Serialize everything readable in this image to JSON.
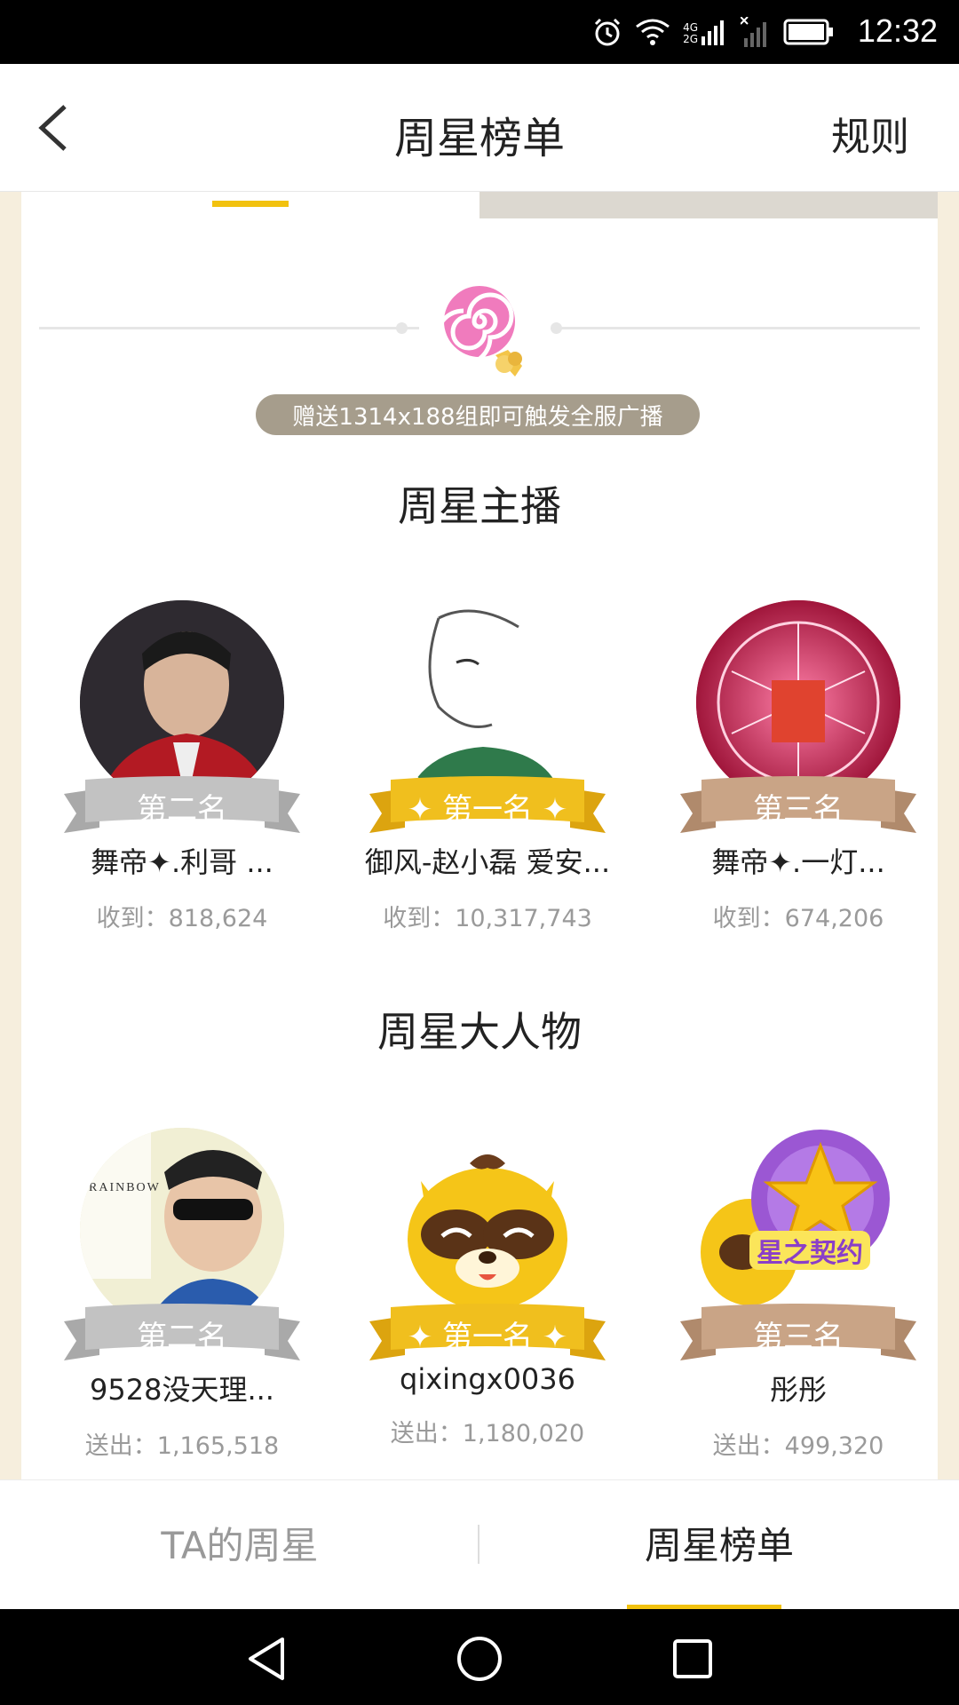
{
  "status_bar": {
    "time": "12:32",
    "icons": [
      "alarm-icon",
      "wifi-icon",
      "signal-4g-icon",
      "signal-2g-icon",
      "battery-icon"
    ],
    "net_label_top": "4G",
    "net_label_bottom": "2G"
  },
  "header": {
    "title": "周星榜单",
    "rules_label": "规则",
    "back_icon": "chevron-left-icon"
  },
  "banner": {
    "gift_icon": "lollipop-icon",
    "hint": "赠送1314x188组即可触发全服广播"
  },
  "anchors": {
    "title": "周星主播",
    "entries": [
      {
        "rank_label": "第二名",
        "name": "舞帝✦.利哥 ...",
        "amount_label": "收到：",
        "amount": "818,624",
        "ribbon": "silver"
      },
      {
        "rank_label": "✦ 第一名 ✦",
        "name": "御风-赵小磊 爱安...",
        "amount_label": "收到：",
        "amount": "10,317,743",
        "ribbon": "gold"
      },
      {
        "rank_label": "第三名",
        "name": "舞帝✦.一灯...",
        "amount_label": "收到：",
        "amount": "674,206",
        "ribbon": "bronze"
      }
    ]
  },
  "bigshots": {
    "title": "周星大人物",
    "entries": [
      {
        "rank_label": "第二名",
        "name": "9528没天理...",
        "amount_label": "送出：",
        "amount": "1,165,518",
        "ribbon": "silver",
        "avatar_text": "RAINBOW"
      },
      {
        "rank_label": "✦ 第一名 ✦",
        "name": "qixingx0036",
        "amount_label": "送出：",
        "amount": "1,180,020",
        "ribbon": "gold"
      },
      {
        "rank_label": "第三名",
        "name": "彤彤",
        "amount_label": "送出：",
        "amount": "499,320",
        "ribbon": "bronze",
        "badge_text": "星之契约"
      }
    ]
  },
  "bottom_tabs": {
    "left": "TA的周星",
    "right": "周星榜单",
    "active": "right"
  },
  "colors": {
    "accent_yellow": "#f2c20f",
    "ribbon_silver": "#c2c2c2",
    "ribbon_gold": "#f0bf1e",
    "ribbon_bronze": "#c9a486",
    "pill_bg": "#a69d8c"
  }
}
